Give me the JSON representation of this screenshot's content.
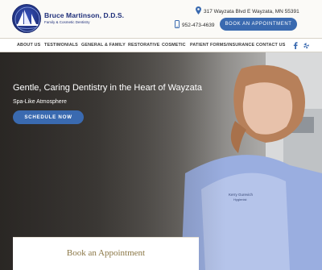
{
  "header": {
    "logo": {
      "name": "Bruce Martinson, D.D.S.",
      "subtitle": "Family & Cosmetic Dentistry"
    },
    "address": "317 Wayzata Blvd E Wayzata, MN 55391",
    "phone": "952-473-4639",
    "book_button": "BOOK AN APPOINTMENT"
  },
  "nav": {
    "items": [
      "ABOUT US",
      "TESTIMONIALS",
      "GENERAL & FAMILY",
      "RESTORATIVE",
      "COSMETIC",
      "PATIENT FORMS/INSURANCE",
      "CONTACT US"
    ],
    "social": [
      "facebook-icon",
      "yelp-icon"
    ]
  },
  "hero": {
    "title": "Gentle, Caring Dentistry in the Heart of Wayzata",
    "subtitle": "Spa-Like Atmosphere",
    "button": "SCHEDULE NOW",
    "scrub_top_text": "Kerry Gurevich",
    "scrub_top_role": "Hygienist"
  },
  "card": {
    "title": "Book an Appointment"
  },
  "colors": {
    "accent": "#3a6ab0",
    "brand": "#1f2f7a",
    "gold": "#8a7645"
  }
}
